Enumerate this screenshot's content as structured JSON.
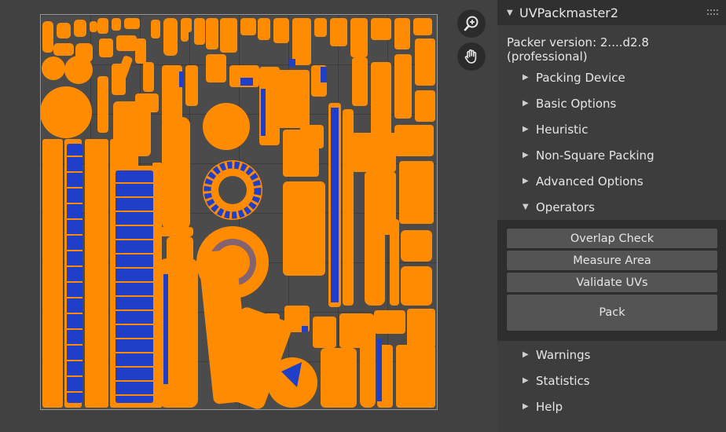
{
  "panel": {
    "title": "UVPackmaster2",
    "version_text": "Packer version: 2....d2.8 (professional)",
    "sections": {
      "packing_device": "Packing Device",
      "basic_options": "Basic Options",
      "heuristic": "Heuristic",
      "non_square": "Non-Square Packing",
      "advanced_options": "Advanced Options",
      "operators": "Operators",
      "warnings": "Warnings",
      "statistics": "Statistics",
      "help": "Help"
    },
    "operators": {
      "overlap_check": "Overlap Check",
      "measure_area": "Measure Area",
      "validate_uvs": "Validate UVs",
      "pack": "Pack"
    }
  },
  "viewport": {
    "zoom_icon": "zoom-in-icon",
    "pan_icon": "hand-pan-icon"
  },
  "colors": {
    "uv_island": "#ff8c00",
    "uv_flipped": "#1f3fc8",
    "panel_bg": "#3d3d3d",
    "header_bg": "#303030",
    "button_bg": "#545454"
  }
}
